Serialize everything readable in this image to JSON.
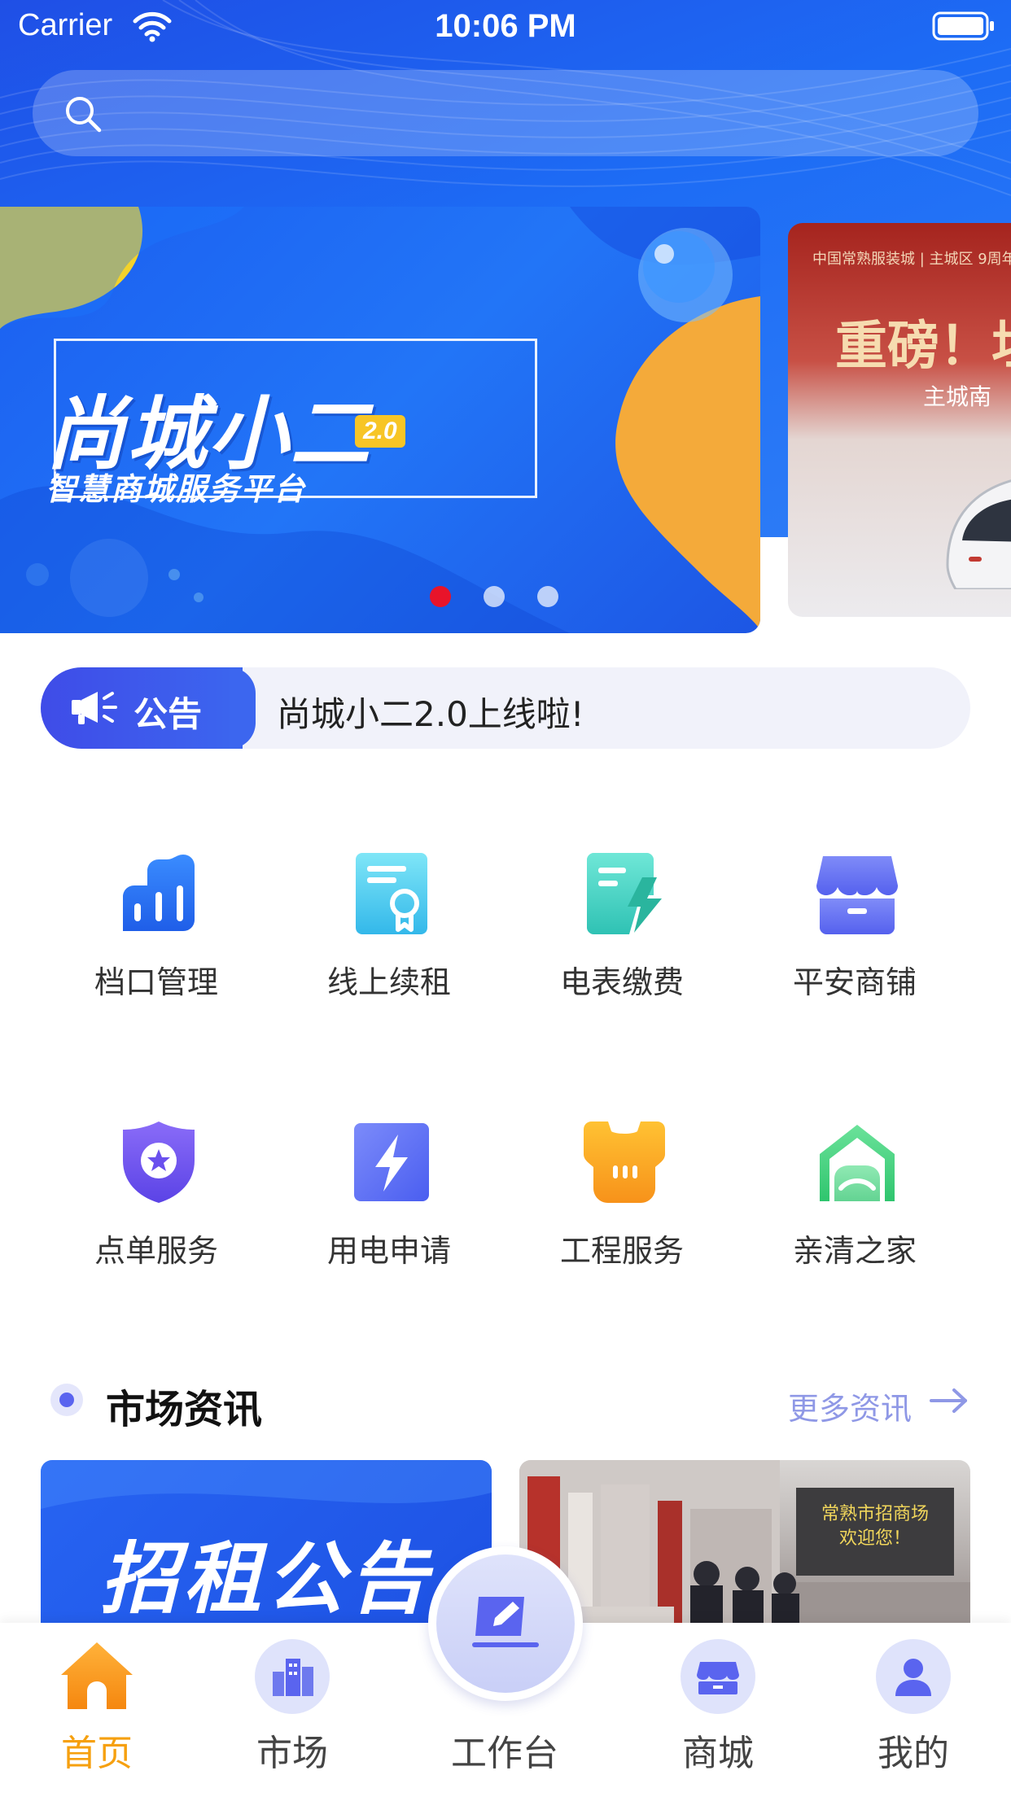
{
  "status_bar": {
    "carrier": "Carrier",
    "time": "10:06 PM"
  },
  "search": {
    "icon": "search-icon"
  },
  "banner": {
    "title": "尚城小二",
    "version": "2.0",
    "subtitle": "智慧商城服务平台",
    "page_count": 3,
    "active_page": 1,
    "side": {
      "header": "中国常熟服装城 | 主城区 9周年",
      "title": "重磅！坦",
      "subtitle": "主城南"
    }
  },
  "notice": {
    "label": "公告",
    "text": "尚城小二2.0上线啦!"
  },
  "grid": {
    "items": [
      {
        "label": "档口管理",
        "icon": "bar-chart-icon"
      },
      {
        "label": "线上续租",
        "icon": "certificate-icon"
      },
      {
        "label": "电表缴费",
        "icon": "bill-lightning-icon"
      },
      {
        "label": "平安商铺",
        "icon": "shop-icon"
      },
      {
        "label": "点单服务",
        "icon": "star-shield-icon"
      },
      {
        "label": "用电申请",
        "icon": "lightning-icon"
      },
      {
        "label": "工程服务",
        "icon": "helmet-icon"
      },
      {
        "label": "亲清之家",
        "icon": "home-icon"
      }
    ]
  },
  "news": {
    "title": "市场资讯",
    "more": "更多资讯",
    "card_1_text": "招租公告",
    "card_2_sign_line_1": "常熟市招商场",
    "card_2_sign_line_2": "欢迎您！"
  },
  "tab_bar": {
    "tabs": [
      {
        "label": "首页",
        "icon": "home-icon",
        "active": true
      },
      {
        "label": "市场",
        "icon": "buildings-icon",
        "active": false
      },
      {
        "label": "工作台",
        "icon": "edit-icon",
        "active": false
      },
      {
        "label": "商城",
        "icon": "store-icon",
        "active": false
      },
      {
        "label": "我的",
        "icon": "user-icon",
        "active": false
      }
    ]
  },
  "colors": {
    "primary": "#1f5fee",
    "accent": "#f6a00f",
    "notice_badge": "#3f4ce8",
    "link": "#8f98e6"
  }
}
